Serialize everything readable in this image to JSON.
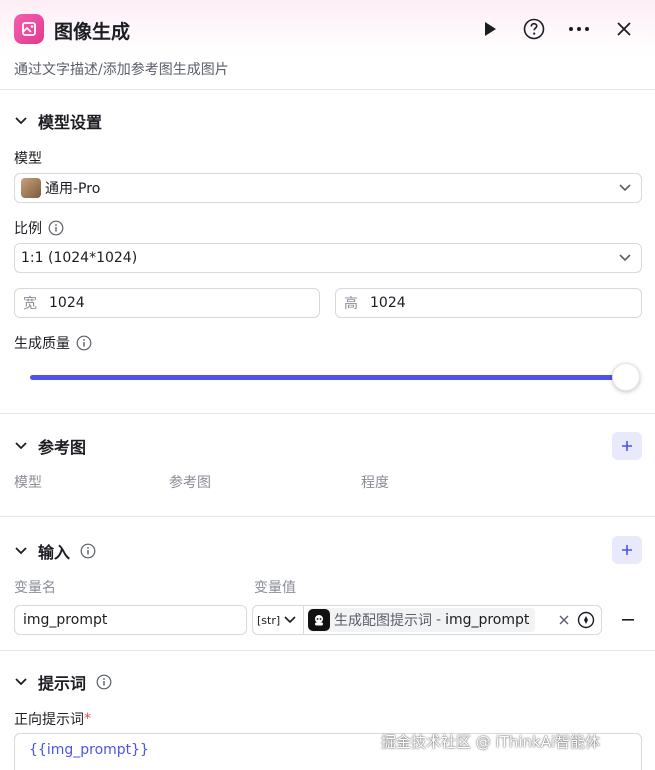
{
  "header": {
    "title": "图像生成",
    "subtitle": "通过文字描述/添加参考图生成图片"
  },
  "model_settings": {
    "title": "模型设置",
    "model_label": "模型",
    "model_value": "通用-Pro",
    "ratio_label": "比例",
    "ratio_value": "1:1 (1024*1024)",
    "width_prefix": "宽",
    "width_value": "1024",
    "height_prefix": "高",
    "height_value": "1024",
    "quality_label": "生成质量",
    "quality_level": 1.0
  },
  "reference": {
    "title": "参考图",
    "columns": [
      "模型",
      "参考图",
      "程度"
    ]
  },
  "input": {
    "title": "输入",
    "col_name": "变量名",
    "col_value": "变量值",
    "var_name": "img_prompt",
    "type_label": "[str]",
    "ref_node": "生成配图提示词",
    "ref_sep": "-",
    "ref_var": "img_prompt"
  },
  "prompt": {
    "title": "提示词",
    "positive_label": "正向提示词",
    "required_mark": "*",
    "positive_value": "{{img_prompt}}"
  },
  "watermark": "掘金技术社区 @ iThinkAi智能体",
  "colors": {
    "accent": "#4d53e8",
    "brand_pink": "#e23a8e"
  }
}
